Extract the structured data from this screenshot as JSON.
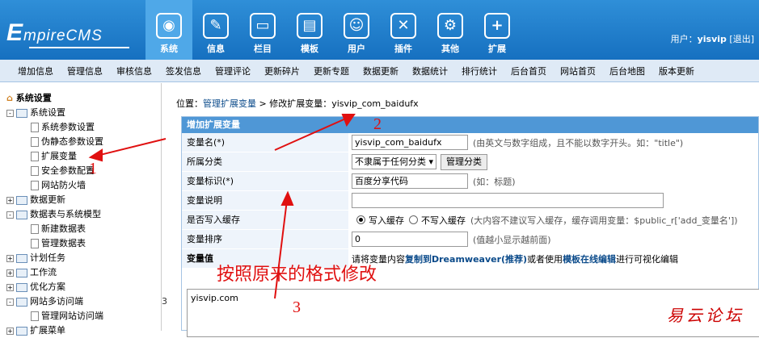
{
  "header": {
    "logo_text_big": "E",
    "logo_text_rest": "mpireCMS",
    "nav": [
      {
        "label": "系统",
        "icon": "globe-icon",
        "glyph": "◉",
        "active": true
      },
      {
        "label": "信息",
        "icon": "notepad-icon",
        "glyph": "✎",
        "active": false
      },
      {
        "label": "栏目",
        "icon": "folder-icon",
        "glyph": "▭",
        "active": false
      },
      {
        "label": "模板",
        "icon": "template-icon",
        "glyph": "▤",
        "active": false
      },
      {
        "label": "用户",
        "icon": "user-icon",
        "glyph": "☺",
        "active": false
      },
      {
        "label": "插件",
        "icon": "tools-icon",
        "glyph": "✕",
        "active": false
      },
      {
        "label": "其他",
        "icon": "gear-icon",
        "glyph": "⚙",
        "active": false
      },
      {
        "label": "扩展",
        "icon": "plus-icon",
        "glyph": "+",
        "active": false
      }
    ],
    "user_prefix": "用户：",
    "username": "yisvip",
    "logout": "[退出]"
  },
  "menubar": [
    "增加信息",
    "管理信息",
    "审核信息",
    "签发信息",
    "管理评论",
    "更新碎片",
    "更新专题",
    "数据更新",
    "数据统计",
    "排行统计",
    "后台首页",
    "网站首页",
    "后台地图",
    "版本更新"
  ],
  "sidebar": {
    "root": "系统设置",
    "items": [
      {
        "label": "系统设置",
        "type": "folder",
        "pm": "-",
        "level": 1
      },
      {
        "label": "系统参数设置",
        "type": "doc",
        "level": 2
      },
      {
        "label": "伪静态参数设置",
        "type": "doc",
        "level": 2
      },
      {
        "label": "扩展变量",
        "type": "doc",
        "level": 2
      },
      {
        "label": "安全参数配置",
        "type": "doc",
        "level": 2
      },
      {
        "label": "网站防火墙",
        "type": "doc",
        "level": 2
      },
      {
        "label": "数据更新",
        "type": "folder",
        "pm": "+",
        "level": 1
      },
      {
        "label": "数据表与系统模型",
        "type": "folder",
        "pm": "-",
        "level": 1
      },
      {
        "label": "新建数据表",
        "type": "doc",
        "level": 2
      },
      {
        "label": "管理数据表",
        "type": "doc",
        "level": 2
      },
      {
        "label": "计划任务",
        "type": "folder",
        "pm": "+",
        "level": 1
      },
      {
        "label": "工作流",
        "type": "folder",
        "pm": "+",
        "level": 1
      },
      {
        "label": "优化方案",
        "type": "folder",
        "pm": "+",
        "level": 1
      },
      {
        "label": "网站多访问端",
        "type": "folder",
        "pm": "-",
        "level": 1
      },
      {
        "label": "管理网站访问端",
        "type": "doc",
        "level": 2
      },
      {
        "label": "扩展菜单",
        "type": "folder",
        "pm": "+",
        "level": 1
      }
    ]
  },
  "breadcrumb": {
    "prefix": "位置：",
    "link": "管理扩展变量",
    "sep": " > ",
    "current": "修改扩展变量：yisvip_com_baidufx"
  },
  "form": {
    "title": "增加扩展变量",
    "var_name_label": "变量名(*)",
    "var_name_value": "yisvip_com_baidufx",
    "var_name_hint": "(由英文与数字组成，且不能以数字开头。如：\"title\")",
    "category_label": "所属分类",
    "category_value": "不隶属于任何分类 ▾",
    "category_button": "管理分类",
    "var_id_label": "变量标识(*)",
    "var_id_value": "百度分享代码",
    "var_id_hint": "(如：标题)",
    "var_desc_label": "变量说明",
    "cache_label": "是否写入缓存",
    "cache_yes": "写入缓存",
    "cache_no": "不写入缓存",
    "cache_hint": "(大内容不建议写入缓存，缓存调用变量：$public_r['add_变量名'])",
    "order_label": "变量排序",
    "order_value": "0",
    "order_hint": "(值越小显示越前面)",
    "value_label": "变量值",
    "value_hint_pre": "请将变量内容",
    "value_hint_link1": "复制到Dreamweaver(推荐)",
    "value_hint_mid": "或者使用",
    "value_hint_link2": "模板在线编辑",
    "value_hint_post": "进行可视化编辑",
    "value_content": "yisvip.com"
  },
  "annotations": {
    "n1": "1",
    "n2": "2",
    "n3": "3",
    "note": "按照原来的格式修改",
    "side_num": "3",
    "watermark": "易云论坛",
    "color": "#e01010"
  }
}
